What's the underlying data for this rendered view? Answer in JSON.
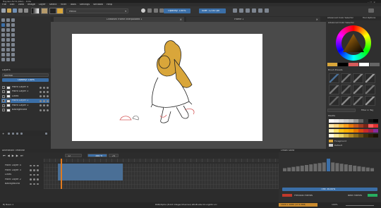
{
  "window": {
    "title": "Hayden-5174 (KRA) – Krita"
  },
  "menu": [
    "File",
    "Edit",
    "View",
    "Image",
    "Layer",
    "Select",
    "Filter",
    "Tools",
    "Settings",
    "Window",
    "Help"
  ],
  "toolbar": {
    "preset_label": "Pencil",
    "opacity_label": "Opacity: 100%",
    "size_label": "Size: 12.00 px"
  },
  "doc_tabs": [
    "Linework Frame interpolated 1",
    "Frame 1"
  ],
  "layers_panel": {
    "title": "Layers",
    "blend": "Normal",
    "opacity": "Opacity: 100%",
    "layers": [
      "Paint Layer 4",
      "Paint Layer 3",
      "Lines",
      "Paint Layer 2",
      "Paint Layer 1",
      "Background"
    ]
  },
  "right_panel": {
    "color_title": "Advanced Color Selector",
    "tab_a": "Advanced Color Selector",
    "tab_b": "Tool Options",
    "presets_title": "Brush Presets",
    "filter_label": "Filter in Tag",
    "palette_title": "Palette",
    "palette_name_1": "Foreground",
    "palette_name_2": "Default"
  },
  "animation": {
    "title": "Animation Timeline",
    "frame": "12",
    "start": "0",
    "fps": "24",
    "speed": "100 %",
    "rows": [
      "Paint Layer 4",
      "Paint Layer 3",
      "Lines",
      "Paint Layer 2",
      "Background"
    ]
  },
  "onion": {
    "title": "Onion Skins",
    "tint_label": "Tint: 30.00%",
    "prev_label": "Previous Frames",
    "next_label": "Next Frames"
  },
  "statusbar": {
    "left": "B) Basic-1",
    "center": "RGB/Alpha (8-bit integer/channel)  sRGB-elle-V2-srgbtrc.icc",
    "right": "1920 x 1080 (17.6 MiB)",
    "zoom": "100%"
  },
  "colors": {
    "accent": "#3b6fa8",
    "hood": "#d9a63a",
    "red": "#c0392b",
    "green": "#27ae60"
  }
}
